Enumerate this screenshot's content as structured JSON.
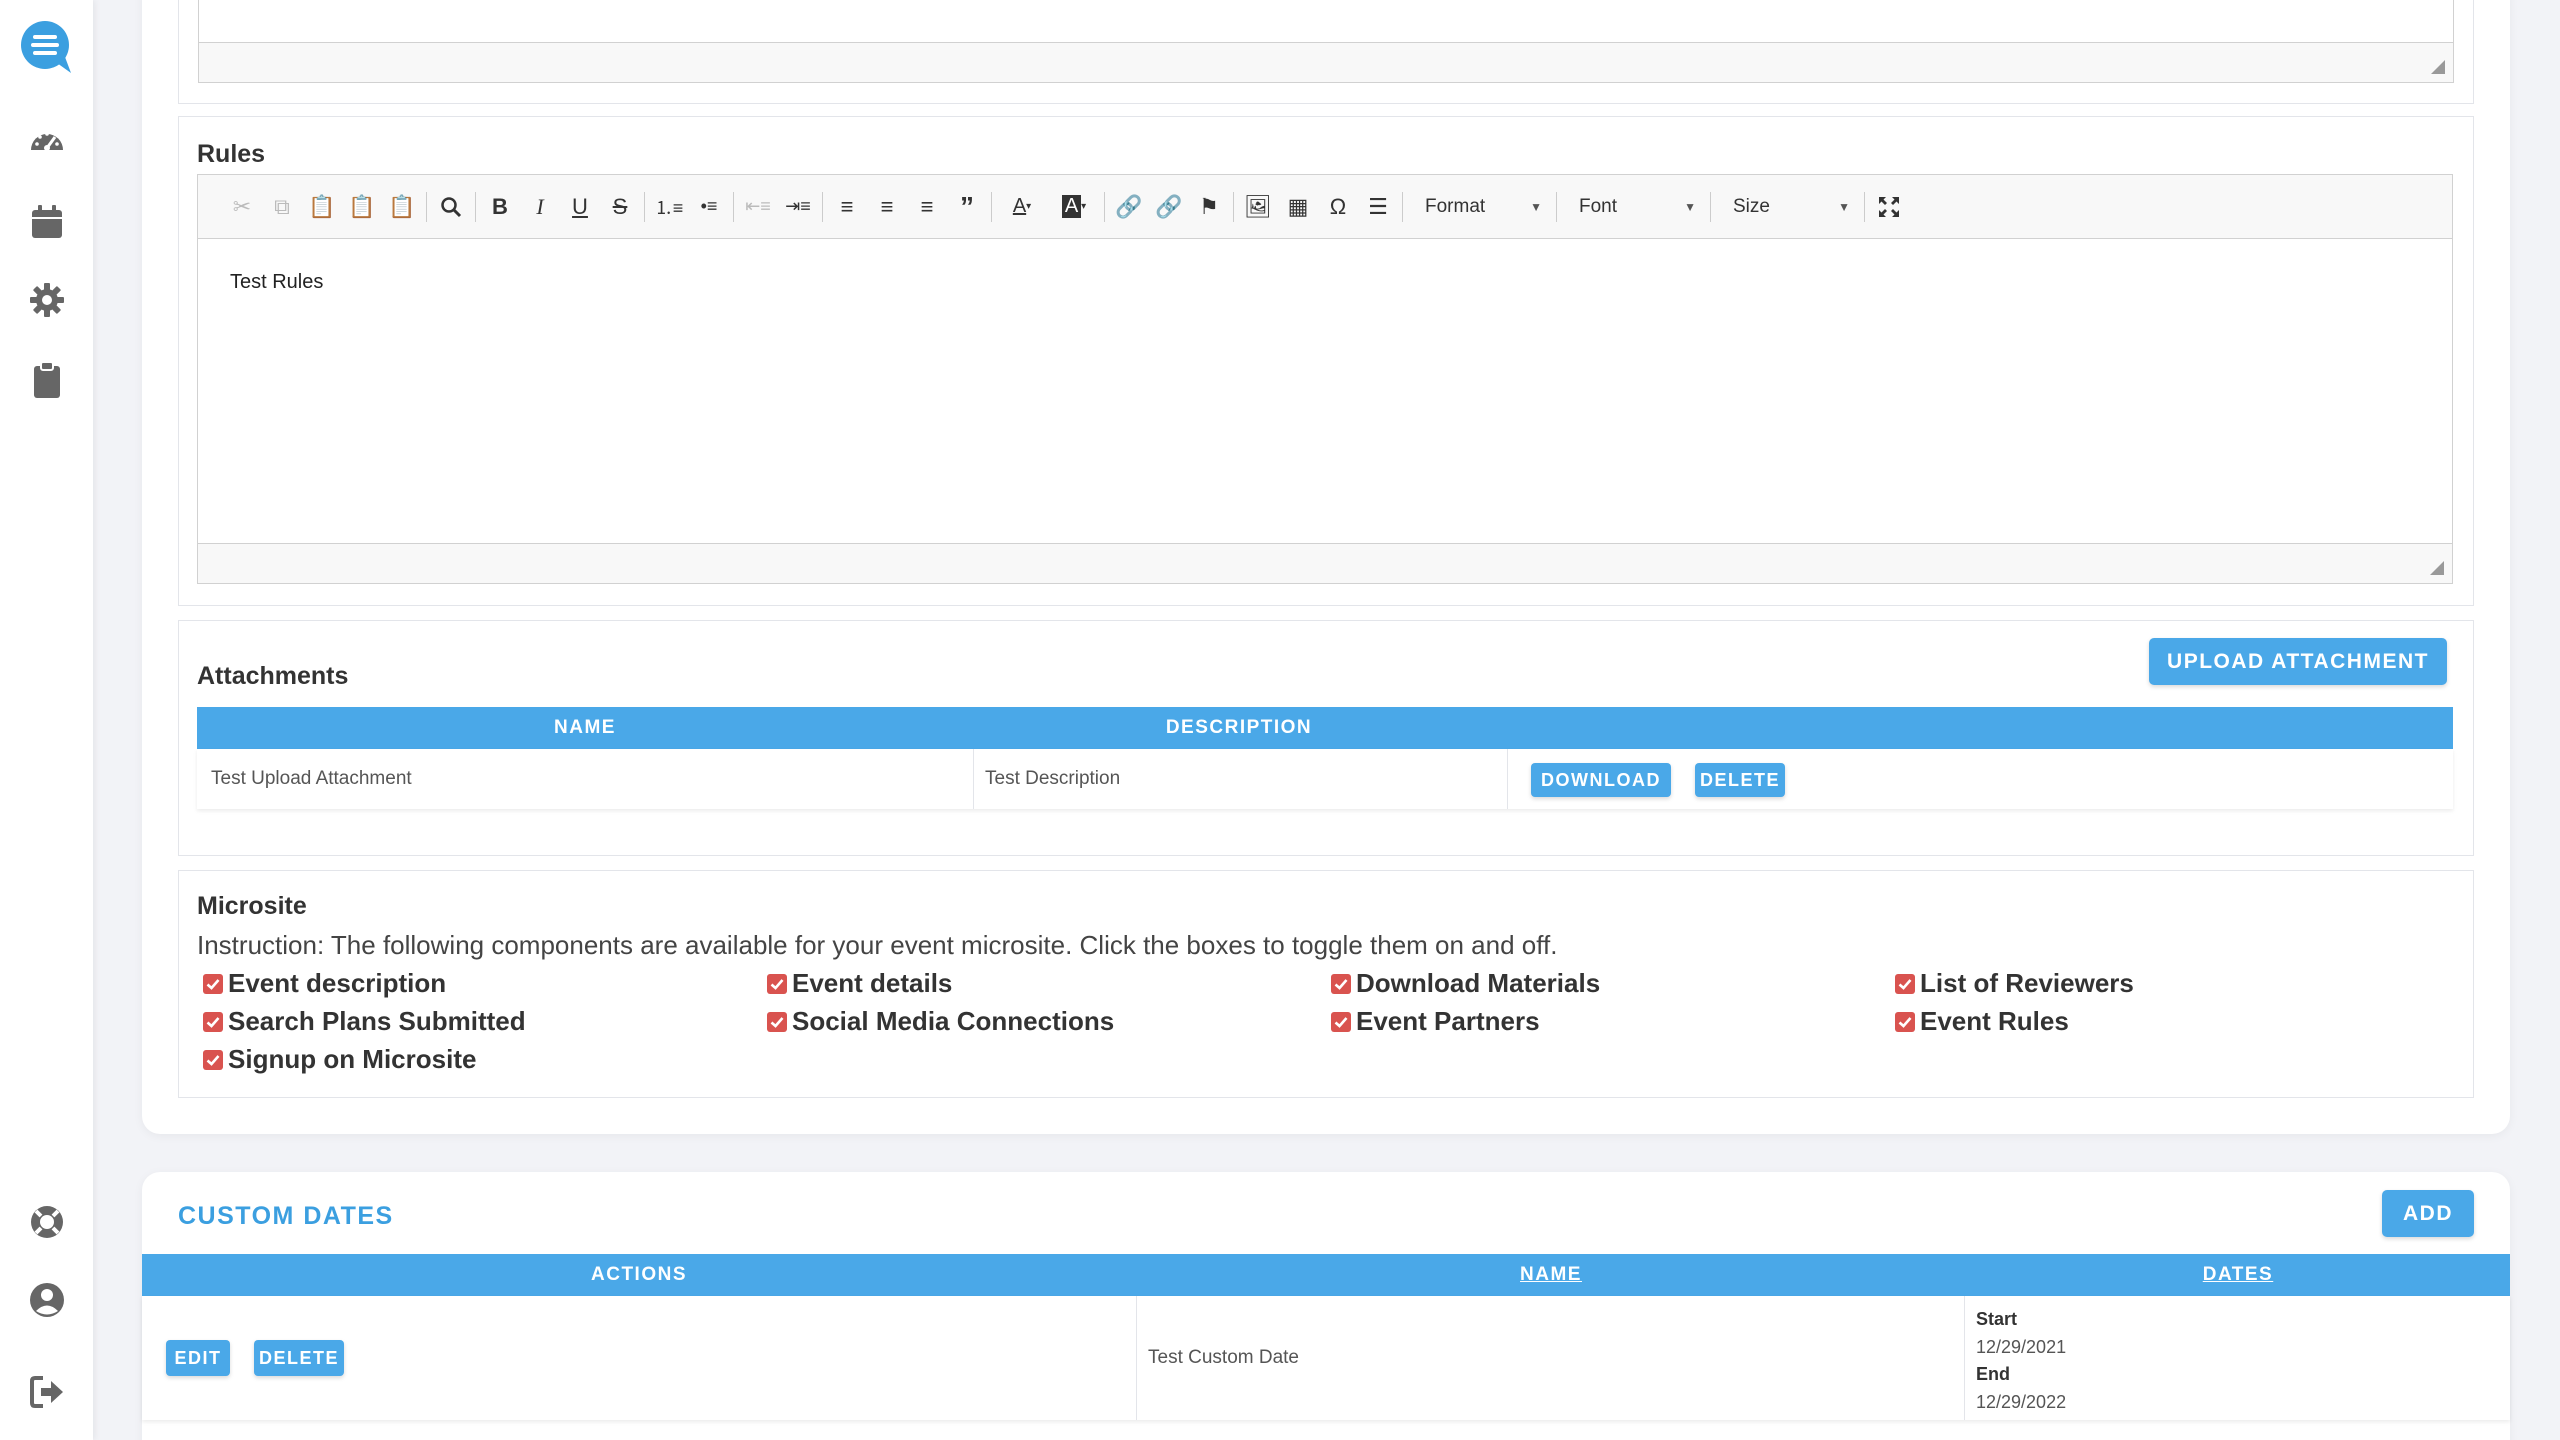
{
  "sidebar": {
    "logo_icon": "chat-logo-icon",
    "top_items": [
      {
        "icon": "dashboard-gauge-icon"
      },
      {
        "icon": "calendar-icon"
      },
      {
        "icon": "gear-icon"
      },
      {
        "icon": "clipboard-icon"
      }
    ],
    "bottom_items": [
      {
        "icon": "support-lifebuoy-icon"
      },
      {
        "icon": "user-profile-icon"
      },
      {
        "icon": "logout-icon"
      }
    ]
  },
  "rules": {
    "title": "Rules",
    "content": "Test Rules",
    "toolbar": {
      "format_label": "Format",
      "font_label": "Font",
      "size_label": "Size"
    }
  },
  "attachments": {
    "title": "Attachments",
    "upload_label": "UPLOAD ATTACHMENT",
    "columns": [
      "NAME",
      "DESCRIPTION"
    ],
    "rows": [
      {
        "name": "Test Upload Attachment",
        "description": "Test Description",
        "download_label": "DOWNLOAD",
        "delete_label": "DELETE"
      }
    ]
  },
  "microsite": {
    "title": "Microsite",
    "instruction": "Instruction: The following components are available for your event microsite. Click the boxes to toggle them on and off.",
    "options": [
      {
        "label": "Event description",
        "checked": true
      },
      {
        "label": "Event details",
        "checked": true
      },
      {
        "label": "Download Materials",
        "checked": true
      },
      {
        "label": "List of Reviewers",
        "checked": true
      },
      {
        "label": "Search Plans Submitted",
        "checked": true
      },
      {
        "label": "Social Media Connections",
        "checked": true
      },
      {
        "label": "Event Partners",
        "checked": true
      },
      {
        "label": "Event Rules",
        "checked": true
      },
      {
        "label": "Signup on Microsite",
        "checked": true
      }
    ]
  },
  "custom_dates": {
    "title": "CUSTOM DATES",
    "add_label": "ADD",
    "columns": [
      "ACTIONS",
      "NAME",
      "DATES"
    ],
    "rows": [
      {
        "edit_label": "EDIT",
        "delete_label": "DELETE",
        "name": "Test Custom Date",
        "start_label": "Start",
        "start": "12/29/2021",
        "end_label": "End",
        "end": "12/29/2022"
      }
    ]
  },
  "colors": {
    "accent": "#4aa8e8",
    "checkbox": "#d9534f",
    "title_blue": "#3b9fe0"
  }
}
